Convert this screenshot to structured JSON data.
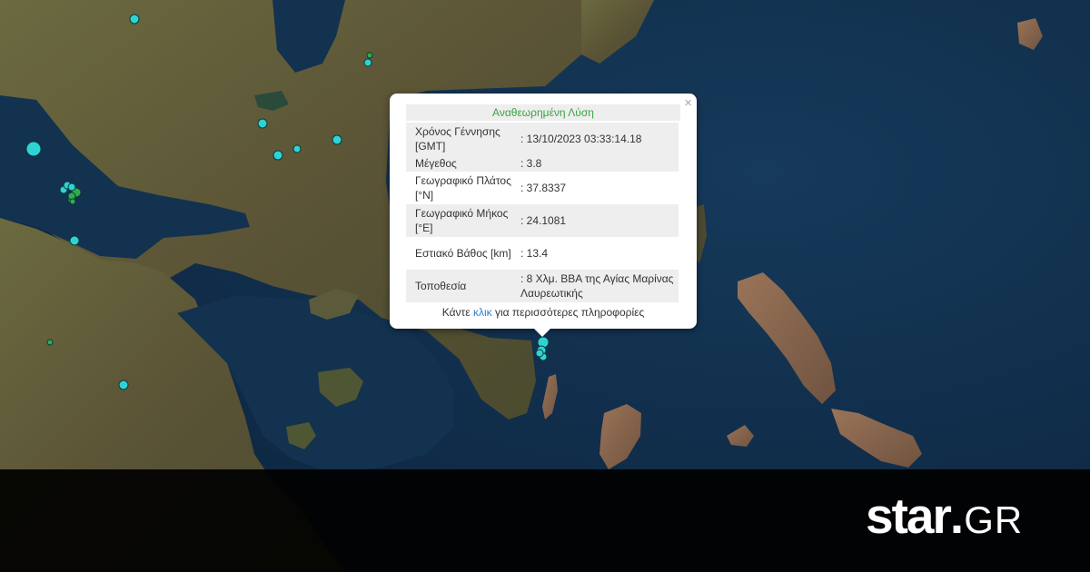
{
  "popup": {
    "title": "Αναθεωρημένη Λύση",
    "close_symbol": "×",
    "rows": [
      {
        "label": "Χρόνος Γέννησης [GMT]",
        "value": ": 13/10/2023 03:33:14.18"
      },
      {
        "label": "Μέγεθος",
        "value": ": 3.8"
      },
      {
        "label": "Γεωγραφικό Πλάτος [°N]",
        "value": ": 37.8337"
      },
      {
        "label": "Γεωγραφικό Μήκος [°E]",
        "value": ": 24.1081"
      },
      {
        "label": "Εστιακό Βάθος [km]",
        "value": ": 13.4"
      },
      {
        "label": "Τοποθεσία",
        "value": ": 8 Χλμ. ΒΒΑ της Αγίας Μαρίνας Λαυρεωτικής"
      }
    ],
    "footer_prefix": "Κάντε ",
    "footer_link": "κλικ",
    "footer_suffix": " για περισσότερες πληροφορίες"
  },
  "brand": {
    "logo_main": "star",
    "logo_dot": ".",
    "logo_suffix": "GR"
  },
  "colors": {
    "sea": "#0f2a44",
    "land": "#5a5236",
    "marker_cyan": "#2fd3d3",
    "marker_green": "#2fae4f",
    "title_green": "#3aa241",
    "link_blue": "#2a86d4"
  },
  "markers": [
    {
      "color": "cyan",
      "r": 5
    },
    {
      "color": "cyan",
      "r": 4
    },
    {
      "color": "green",
      "r": 3
    },
    {
      "color": "cyan",
      "r": 8
    },
    {
      "color": "cyan",
      "r": 5
    },
    {
      "color": "cyan",
      "r": 4
    },
    {
      "color": "cyan",
      "r": 5
    },
    {
      "color": "cyan",
      "r": 5
    },
    {
      "color": "cyan",
      "r": 4
    },
    {
      "color": "green",
      "r": 5
    },
    {
      "color": "green",
      "r": 4
    },
    {
      "color": "cyan",
      "r": 4
    },
    {
      "color": "cyan",
      "r": 4
    },
    {
      "color": "green",
      "r": 4
    },
    {
      "color": "cyan",
      "r": 5
    },
    {
      "color": "cyan",
      "r": 6
    },
    {
      "color": "cyan",
      "r": 5
    },
    {
      "color": "cyan",
      "r": 4
    },
    {
      "color": "cyan",
      "r": 4
    },
    {
      "color": "green",
      "r": 3
    },
    {
      "color": "green",
      "r": 3
    },
    {
      "color": "cyan",
      "r": 5
    }
  ]
}
